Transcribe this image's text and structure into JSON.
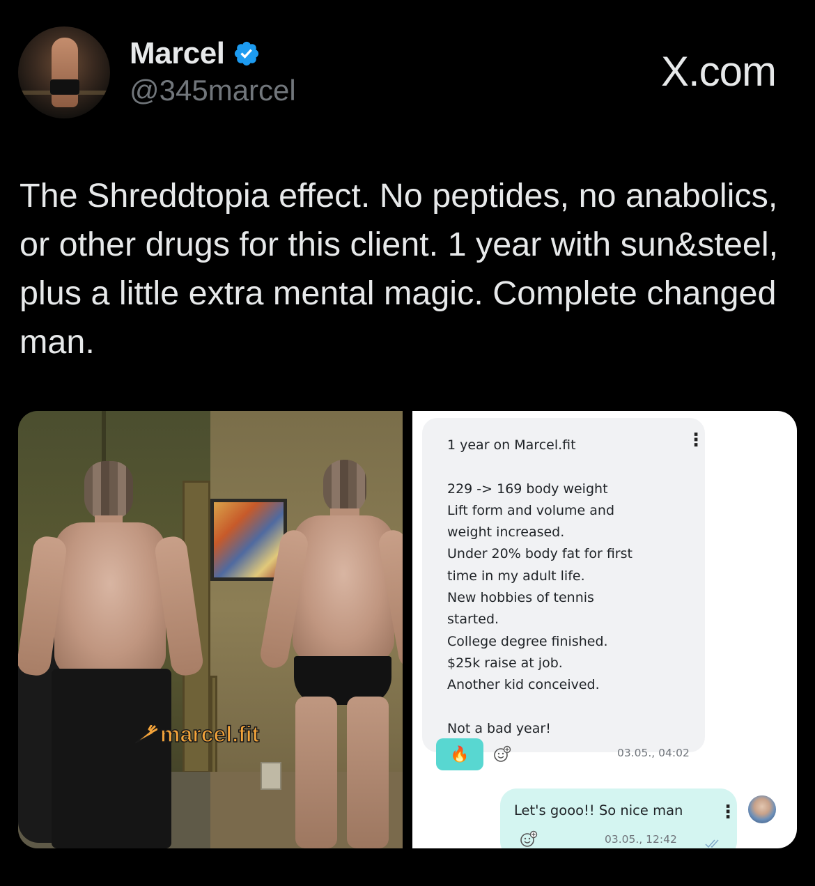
{
  "author": {
    "name": "Marcel",
    "handle": "@345marcel"
  },
  "site_label": "X.com",
  "tweet": {
    "text": "The Shreddtopia effect. No peptides, no anabolics, or other drugs for this client. 1 year with sun&steel, plus a little extra mental magic. Complete changed man."
  },
  "media": {
    "watermark": "marcel.fit",
    "chat": {
      "message_text": "1 year on Marcel.fit\n\n229 -> 169 body weight\nLift form and volume and\nweight increased.\nUnder 20% body fat for first\ntime in my adult life.\nNew hobbies of tennis\nstarted.\nCollege degree finished.\n$25k raise at job.\nAnother  kid conceived.\n\nNot a bad year!",
      "message_time": "03.05., 04:02",
      "reaction_emoji": "🔥",
      "reply_text": "Let's gooo!! So nice man",
      "reply_time": "03.05., 12:42"
    }
  },
  "colors": {
    "verified_blue": "#1d9bf0",
    "watermark_orange": "#f4a43a",
    "reaction_teal": "#58d7d1",
    "reply_bubble": "#d4f5f1"
  }
}
